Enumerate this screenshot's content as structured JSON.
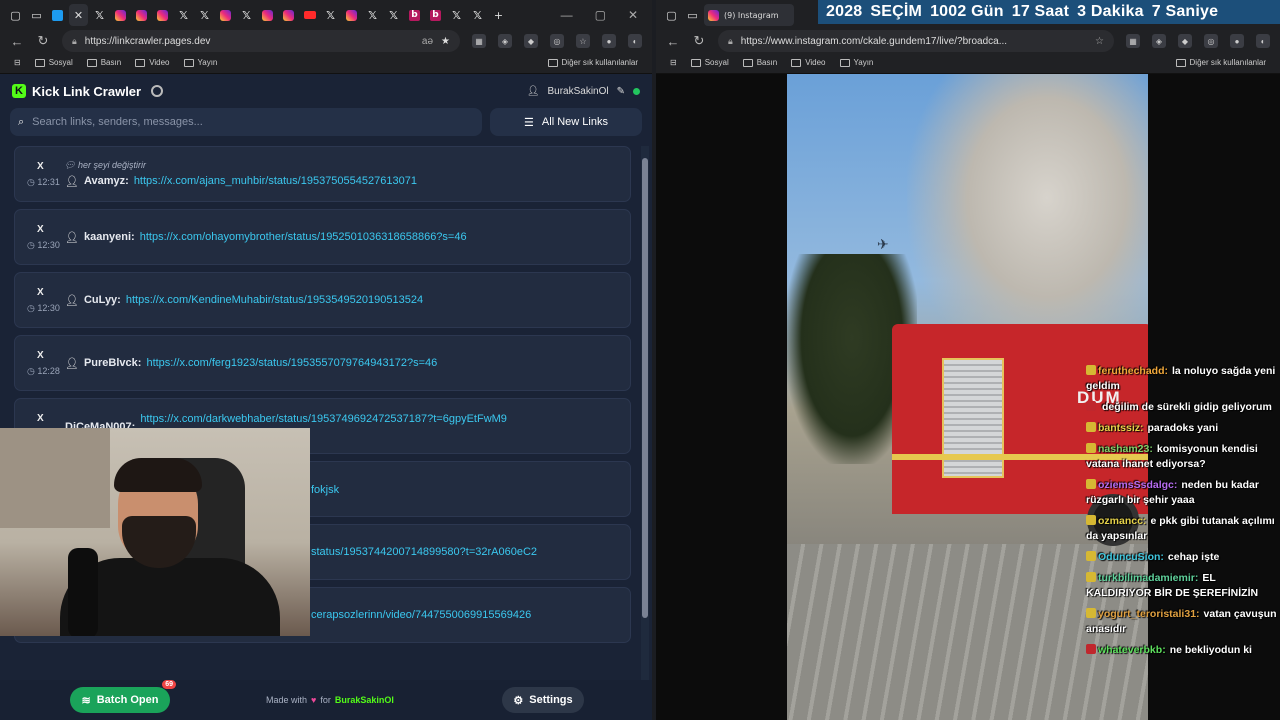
{
  "left_browser": {
    "url": "https://linkcrawler.pages.dev",
    "zoom": "aə",
    "bookmarks": [
      "Sosyal",
      "Basın",
      "Video",
      "Yayın"
    ],
    "other_bookmarks": "Diğer sık kullanılanlar"
  },
  "app": {
    "title": "Kick Link Crawler",
    "username": "BurakSakinOl",
    "search_placeholder": "Search links, senders, messages...",
    "filter_label": "All New Links",
    "rows": [
      {
        "source": "X",
        "time": "12:31",
        "message": "her şeyi değiştirir",
        "sender": "Avamyz:",
        "link": "https://x.com/ajans_muhbir/status/1953750554527613071"
      },
      {
        "source": "X",
        "time": "12:30",
        "message": "",
        "sender": "kaanyeni:",
        "link": "https://x.com/ohayomybrother/status/1952501036318658866?s=46"
      },
      {
        "source": "X",
        "time": "12:30",
        "message": "",
        "sender": "CuLyy:",
        "link": "https://x.com/KendineMuhabir/status/1953549520190513524"
      },
      {
        "source": "X",
        "time": "12:28",
        "message": "",
        "sender": "PureBlvck:",
        "link": "https://x.com/ferg1923/status/1953557079764943172?s=46"
      },
      {
        "source": "X",
        "time": "",
        "message": "",
        "sender": "DiCeMaN007:",
        "link": "https://x.com/darkwebhaber/status/1953749692472537187?t=6gpyEtFwM9"
      },
      {
        "source": "",
        "time": "",
        "message": "",
        "sender": "",
        "link": "fokjsk"
      },
      {
        "source": "",
        "time": "",
        "message": "",
        "sender": "",
        "link": "status/1953744200714899580?t=32rA060eC2"
      },
      {
        "source": "",
        "time": "",
        "message": "",
        "sender": "",
        "link": "cerapsozlerinn/video/7447550069915569426"
      }
    ],
    "batch_label": "Batch Open",
    "batch_count": "69",
    "made_with": "Made with",
    "made_for": "for",
    "made_owner": "BurakSakinOl",
    "settings_label": "Settings"
  },
  "right_browser": {
    "tab_title": "(9) Instagram",
    "url": "https://www.instagram.com/ckale.gundem17/live/?broadca...",
    "bookmarks": [
      "Sosyal",
      "Basın",
      "Video",
      "Yayın"
    ],
    "other_bookmarks": "Diğer sık kullanılanlar"
  },
  "countdown": {
    "items": [
      "2028",
      "SEÇİM",
      "1002 Gün",
      "17 Saat",
      "3 Dakika",
      "7 Saniye"
    ]
  },
  "video": {
    "truck_text": "DUM"
  },
  "chat": [
    {
      "user": "feruthechadd:",
      "text": "la noluyo sağda yeni geldim",
      "color": "#f2a93b"
    },
    {
      "user": "",
      "text": "değilim de sürekli gidip geliyorum",
      "color": "#c0272d"
    },
    {
      "user": "bantssiz:",
      "text": "paradoks yani",
      "color": "#e6d24a"
    },
    {
      "user": "nasham23:",
      "text": "komisyonun kendisi vatana ihanet ediyorsa?",
      "color": "#7fd36b"
    },
    {
      "user": "oziemsSsdalgc:",
      "text": "neden bu kadar rüzgarlı bir şehir yaaa",
      "color": "#b66cf0"
    },
    {
      "user": "ozmancc:",
      "text": "e pkk gibi tutanak açılımı da yapsınlar",
      "color": "#e6d24a"
    },
    {
      "user": "OduncuSion:",
      "text": "cehap işte",
      "color": "#40c8e0"
    },
    {
      "user": "turkbilimadamiemir:",
      "text": "EL KALDIRIYOR BİR DE ŞEREFİNİZİN",
      "color": "#5fd19b"
    },
    {
      "user": "yogurt_teroristali31:",
      "text": "vatan çavuşun anasıdır",
      "color": "#e0a040"
    },
    {
      "user": "whateverbkb:",
      "text": "ne bekliyodun ki",
      "color": "#5ee05e"
    }
  ]
}
